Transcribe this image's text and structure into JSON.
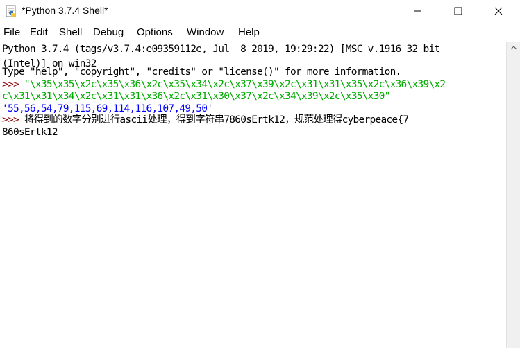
{
  "window": {
    "title": "*Python 3.7.4 Shell*",
    "icon": "python-idle-icon",
    "controls": [
      "minimize-icon",
      "maximize-icon",
      "close-icon"
    ]
  },
  "menu": [
    "File",
    "Edit",
    "Shell",
    "Debug",
    "Options",
    "Window",
    "Help"
  ],
  "shell": {
    "banner_line1": "Python 3.7.4 (tags/v3.7.4:e09359112e, Jul  8 2019, 19:29:22) [MSC v.1916 32 bit",
    "banner_line2": "(Intel)] on win32",
    "banner_line3": "Type \"help\", \"copyright\", \"credits\" or \"license()\" for more information.",
    "prompt": ">>> ",
    "input1_line1": "\"\\x35\\x35\\x2c\\x35\\x36\\x2c\\x35\\x34\\x2c\\x37\\x39\\x2c\\x31\\x31\\x35\\x2c\\x36\\x39\\x2",
    "input1_line2": "c\\x31\\x31\\x34\\x2c\\x31\\x31\\x36\\x2c\\x31\\x30\\x37\\x2c\\x34\\x39\\x2c\\x35\\x30\"",
    "output1": "'55,56,54,79,115,69,114,116,107,49,50'",
    "prompt2": ">>> ",
    "input2_line1": "将得到的数字分别进行ascii处理，得到字符串7860sErtk12，规范处理得cyberpeace{7",
    "input2_line2": "860sErtk12"
  },
  "colors": {
    "prompt": "#8b0000",
    "string": "#00aa00",
    "output": "#0000ff",
    "text": "#000000"
  }
}
